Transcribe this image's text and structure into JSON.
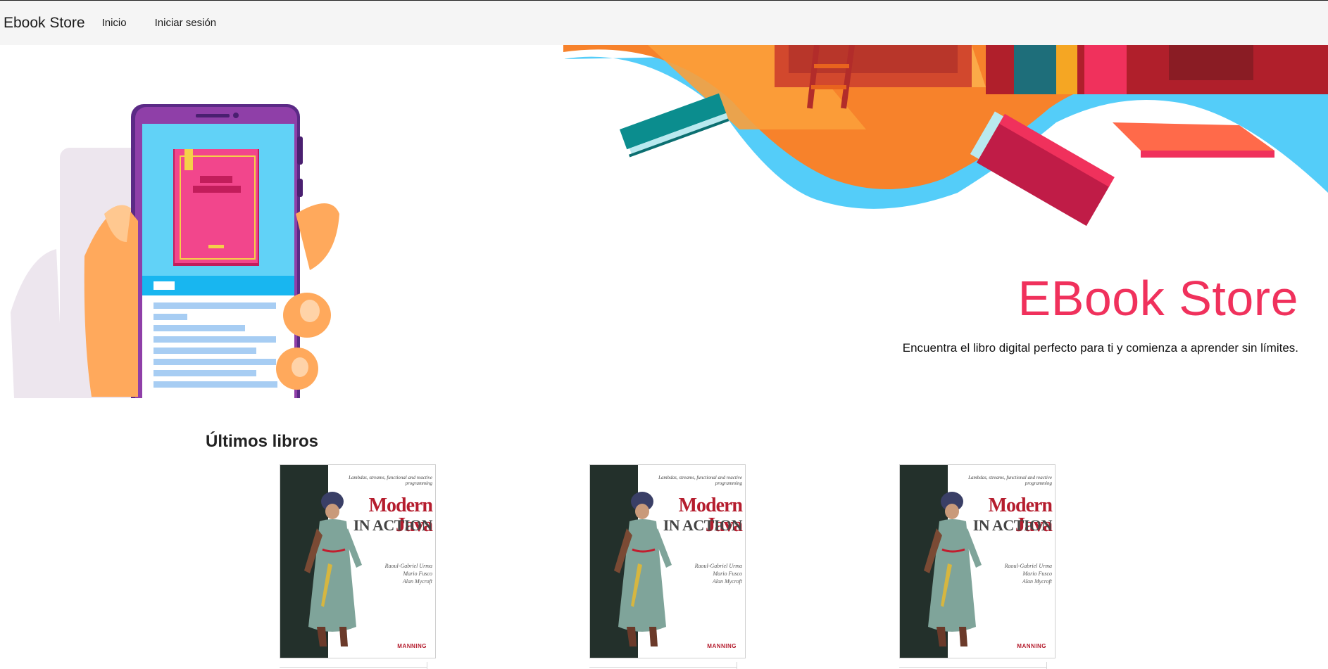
{
  "navbar": {
    "brand": "Ebook Store",
    "links": [
      {
        "label": "Inicio"
      },
      {
        "label": "Iniciar sesión"
      }
    ]
  },
  "hero": {
    "title": "EBook Store",
    "subtitle": "Encuentra el libro digital perfecto para ti y comienza a aprender sin límites."
  },
  "latest": {
    "heading": "Últimos libros",
    "books": [
      {
        "tagline": "Lambdas, streams, functional and reactive programming",
        "title_line1": "Modern Java",
        "title_line2": "IN ACTION",
        "authors": "Raoul-Gabriel Urma\nMario Fusco\nAlan Mycroft",
        "publisher": "MANNING"
      },
      {
        "tagline": "Lambdas, streams, functional and reactive programming",
        "title_line1": "Modern Java",
        "title_line2": "IN ACTION",
        "authors": "Raoul-Gabriel Urma\nMario Fusco\nAlan Mycroft",
        "publisher": "MANNING"
      },
      {
        "tagline": "Lambdas, streams, functional and reactive programming",
        "title_line1": "Modern Java",
        "title_line2": "IN ACTION",
        "authors": "Raoul-Gabriel Urma\nMario Fusco\nAlan Mycroft",
        "publisher": "MANNING"
      }
    ]
  },
  "colors": {
    "accent": "#f0315c",
    "navbar_bg": "#f5f5f5",
    "wave_blue": "#54cdf9",
    "shelf_orange": "#f7822b"
  }
}
